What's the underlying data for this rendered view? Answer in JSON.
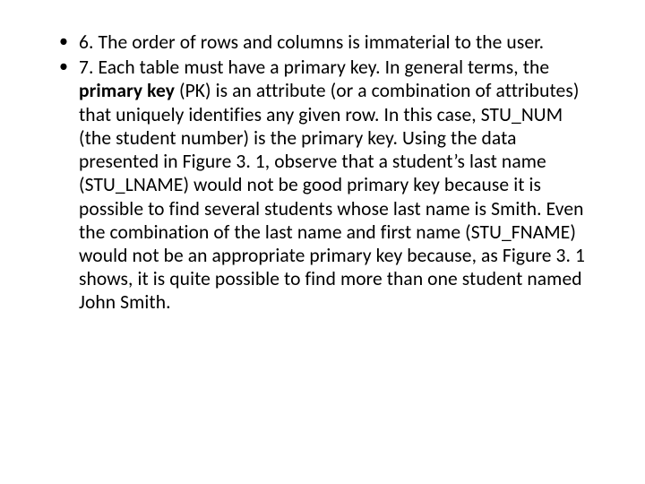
{
  "slide": {
    "bullets": [
      {
        "prefix": "6. ",
        "body_a": "The order of rows and columns is immaterial to the user."
      },
      {
        "prefix": "7. ",
        "body_a": "Each table must have a primary key. In general terms, the ",
        "bold": "primary key ",
        "body_b": "(PK) is an attribute (or a combination of attributes) that uniquely identifies any given row. In this case, STU_NUM (the student number) is the primary key. Using the data presented in Figure 3. 1, observe that a student’s last name (STU_LNAME) would not be good primary key because it is possible to find several students whose last name is Smith. Even the combination of the last name and first name (STU_FNAME) would not be an appropriate primary key because, as Figure 3. 1 shows, it is quite possible to find more than one student named John Smith."
      }
    ]
  }
}
